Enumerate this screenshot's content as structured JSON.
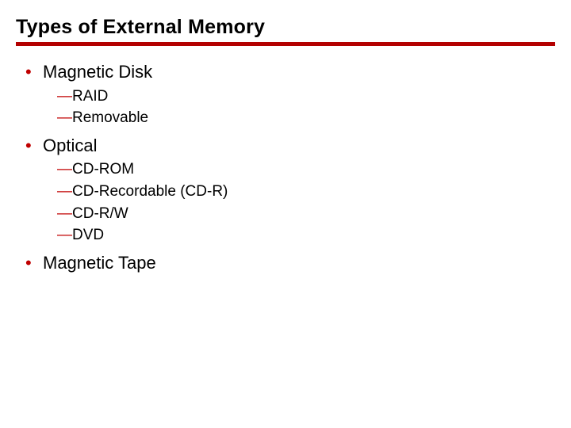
{
  "title": "Types of External Memory",
  "colors": {
    "accent": "#c00000"
  },
  "items": [
    {
      "label": "Magnetic Disk",
      "sub": [
        {
          "text": "RAID"
        },
        {
          "text": "Removable"
        }
      ]
    },
    {
      "label": "Optical",
      "sub": [
        {
          "text": "CD-ROM"
        },
        {
          "text": "CD-Recordable (CD-R)"
        },
        {
          "text": "CD-R/W"
        },
        {
          "text": "DVD"
        }
      ]
    },
    {
      "label": "Magnetic Tape",
      "sub": []
    }
  ]
}
